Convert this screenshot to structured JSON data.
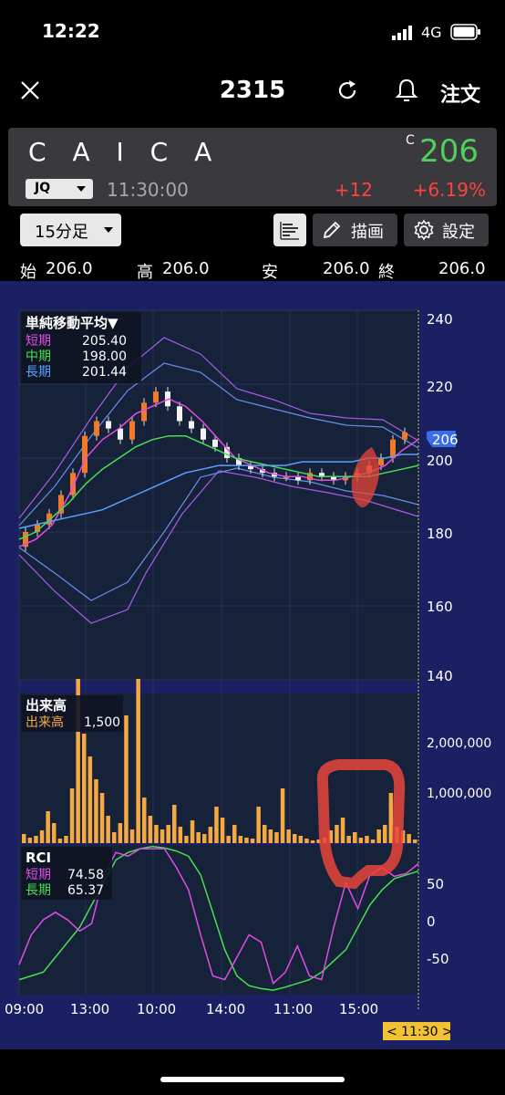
{
  "status_bar": {
    "time": "12:22",
    "network": "4G"
  },
  "nav": {
    "ticker": "2315",
    "order_label": "注文",
    "icons": [
      "close-icon",
      "refresh-icon",
      "bell-icon"
    ]
  },
  "quote": {
    "name": "C A I C A",
    "close_flag": "C",
    "price": "206",
    "market": "JQ",
    "time": "11:30:00",
    "change": "+12",
    "change_pct": "+6.19%",
    "colors": {
      "price": "#4ed05a",
      "change": "#ff4141"
    }
  },
  "toolbar": {
    "interval": "15分足",
    "draw_label": "描画",
    "settings_label": "設定"
  },
  "ohlc": {
    "open_label": "始",
    "open": "206.0",
    "high_label": "高",
    "high": "206.0",
    "low_label": "安",
    "low": "206.0",
    "close_label": "終",
    "close": "206.0"
  },
  "ma_panel": {
    "title": "単純移動平均▼",
    "rows": [
      {
        "label": "短期",
        "value": "205.40",
        "color": "#e04ce6"
      },
      {
        "label": "中期",
        "value": "198.00",
        "color": "#46e04e"
      },
      {
        "label": "長期",
        "value": "201.44",
        "color": "#5aa0ff"
      }
    ],
    "price_axis": [
      "240",
      "220",
      "200",
      "180",
      "160",
      "140"
    ],
    "price_tag": "206"
  },
  "volume_panel": {
    "title": "出来高",
    "label": "出来高",
    "value": "1,500",
    "axis": [
      "2,000,000",
      "1,000,000"
    ]
  },
  "rci_panel": {
    "title": "RCI",
    "rows": [
      {
        "label": "短期",
        "value": "74.58",
        "color": "#e04ce6"
      },
      {
        "label": "長期",
        "value": "65.37",
        "color": "#46e04e"
      }
    ],
    "axis": [
      "50",
      "0",
      "-50"
    ]
  },
  "time_axis": [
    "09:00",
    "13:00",
    "10:00",
    "14:00",
    "11:00",
    "15:00"
  ],
  "cursor_time": "< 11:30 >",
  "chart_data": {
    "type": "line",
    "series": [
      {
        "name": "短期",
        "values": [
          176,
          178,
          182,
          190,
          200,
          205,
          208,
          212,
          214,
          216,
          214,
          210,
          205,
          200,
          198,
          196,
          195,
          195,
          194,
          194,
          195,
          196,
          198,
          202,
          205
        ]
      },
      {
        "name": "中期",
        "values": [
          178,
          180,
          184,
          188,
          193,
          197,
          200,
          203,
          205,
          206,
          206,
          204,
          202,
          200,
          199,
          198,
          197,
          196,
          195,
          195,
          195,
          195,
          196,
          197,
          198
        ]
      },
      {
        "name": "長期",
        "values": [
          181,
          182,
          183,
          184,
          185,
          186,
          188,
          190,
          192,
          194,
          196,
          197,
          198,
          198,
          198,
          198,
          198,
          199,
          199,
          199,
          199,
          200,
          200,
          201,
          201
        ]
      }
    ],
    "ylim": [
      140,
      240
    ]
  }
}
